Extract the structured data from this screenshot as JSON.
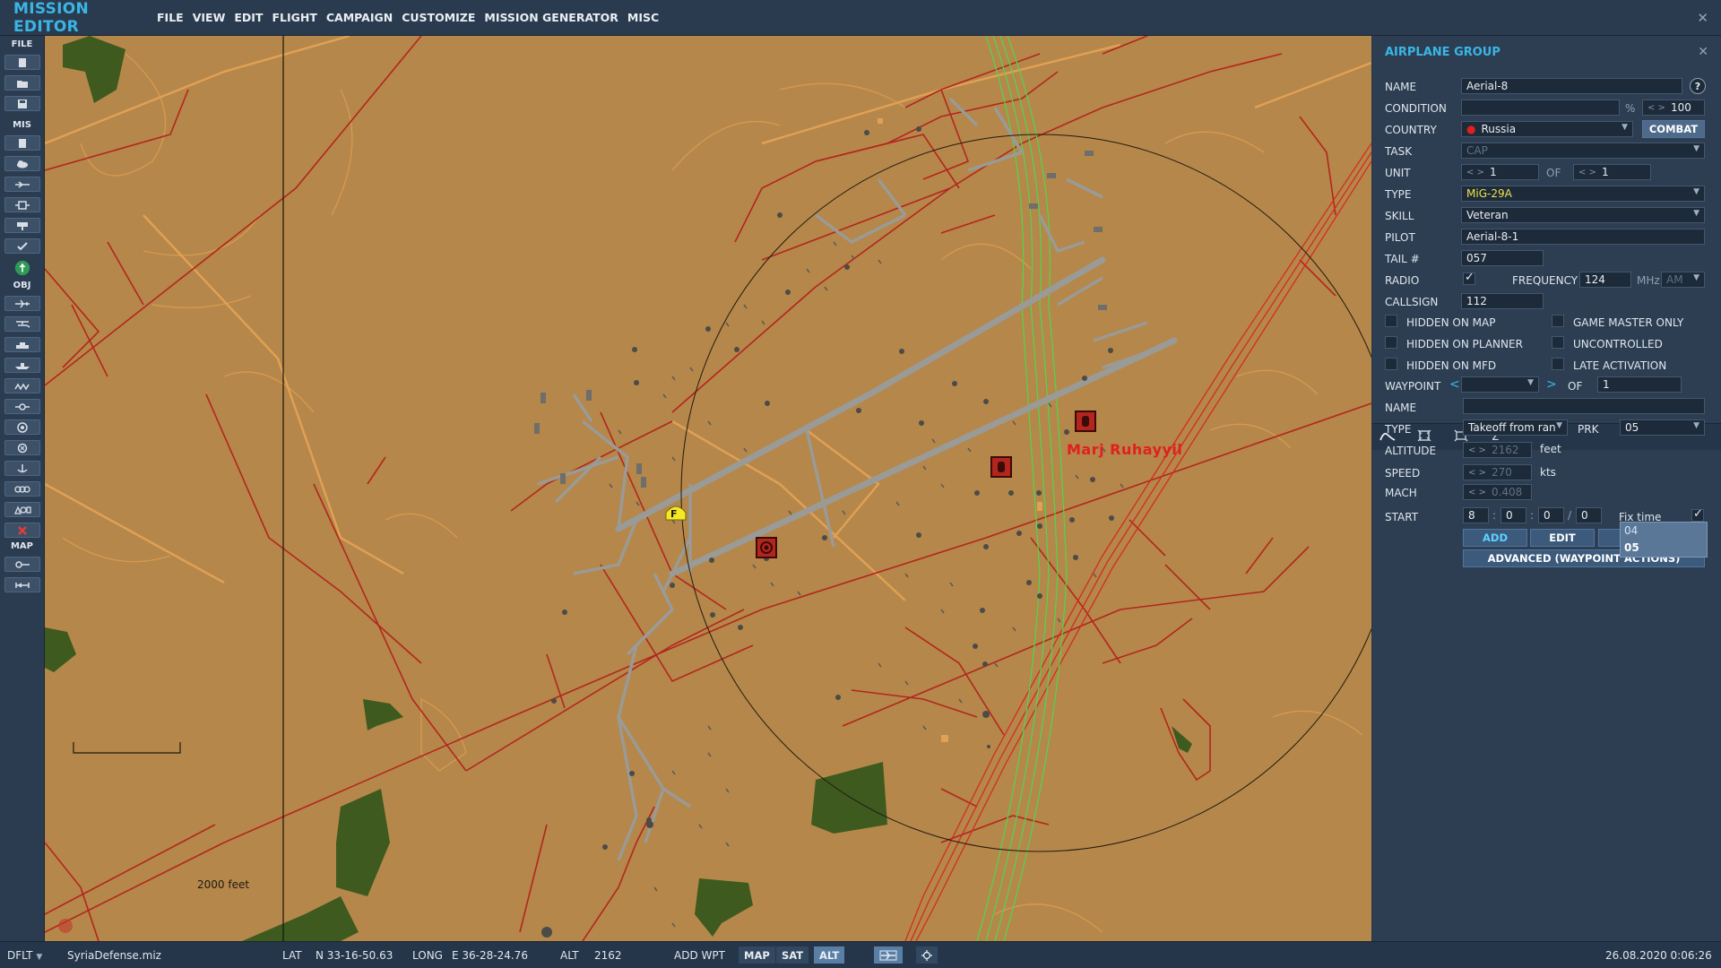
{
  "app": {
    "title": "MISSION EDITOR",
    "menu": [
      "FILE",
      "VIEW",
      "EDIT",
      "FLIGHT",
      "CAMPAIGN",
      "CUSTOMIZE",
      "MISSION GENERATOR",
      "MISC"
    ]
  },
  "toolbar": {
    "sections": [
      "FILE",
      "MIS",
      "OBJ",
      "MAP"
    ]
  },
  "map": {
    "place_label": "Marj Ruhayyil",
    "scale_label": "2000 feet",
    "marker_letter": "F"
  },
  "panel": {
    "title": "AIRPLANE GROUP",
    "help": "?",
    "fields": {
      "name_label": "NAME",
      "name_value": "Aerial-8",
      "condition_label": "CONDITION",
      "condition_pct": "%",
      "condition_value": "100",
      "country_label": "COUNTRY",
      "country_value": "Russia",
      "combat_button": "COMBAT",
      "task_label": "TASK",
      "task_value": "CAP",
      "unit_label": "UNIT",
      "unit_value": "1",
      "unit_of": "OF",
      "unit_total": "1",
      "type_label": "TYPE",
      "type_value": "MiG-29A",
      "skill_label": "SKILL",
      "skill_value": "Veteran",
      "pilot_label": "PILOT",
      "pilot_value": "Aerial-8-1",
      "tail_label": "TAIL #",
      "tail_value": "057",
      "radio_label": "RADIO",
      "frequency_label": "FREQUENCY",
      "frequency_value": "124",
      "mhz": "MHz",
      "modulation": "AM",
      "callsign_label": "CALLSIGN",
      "callsign_value": "112"
    },
    "checkboxes": {
      "hidden_on_map": "HIDDEN ON MAP",
      "hidden_on_planner": "HIDDEN ON PLANNER",
      "hidden_on_mfd": "HIDDEN ON MFD",
      "game_master_only": "GAME MASTER ONLY",
      "uncontrolled": "UNCONTROLLED",
      "late_activation": "LATE ACTIVATION"
    },
    "waypoint": {
      "waypoint_label": "WAYPOINT",
      "of": "OF",
      "total": "1",
      "name_label": "NAME",
      "type_label": "TYPE",
      "type_value": "Takeoff from ran",
      "prk_label": "PRK",
      "prk_value": "05",
      "prk_options": [
        "04",
        "05"
      ],
      "altitude_label": "ALTITUDE",
      "altitude_value": "2162",
      "altitude_unit": "feet",
      "speed_label": "SPEED",
      "speed_value": "270",
      "speed_unit": "kts",
      "mach_label": "MACH",
      "mach_value": "0.408",
      "start_label": "START",
      "start_d": "8",
      "start_h": "0",
      "start_m": "0",
      "start_s": "0",
      "fix_time": "Fix time",
      "add": "ADD",
      "edit": "EDIT",
      "del": "DEL",
      "advanced": "ADVANCED (WAYPOINT ACTIONS)"
    }
  },
  "status": {
    "mode": "DFLT",
    "file": "SyriaDefense.miz",
    "lat_label": "LAT",
    "lat_value": "N 33-16-50.63",
    "long_label": "LONG",
    "long_value": "E 36-28-24.76",
    "alt_label": "ALT",
    "alt_value": "2162",
    "add_wpt": "ADD WPT",
    "map": "MAP",
    "sat": "SAT",
    "alt_btn": "ALT",
    "datetime": "26.08.2020 0:06:26"
  },
  "colors": {
    "accent": "#39b6e6",
    "map_ground": "#b5874a",
    "road": "#b3261e",
    "runway": "#9a9a96",
    "forest": "#3e5a1f",
    "power_line": "#4fd84a"
  }
}
